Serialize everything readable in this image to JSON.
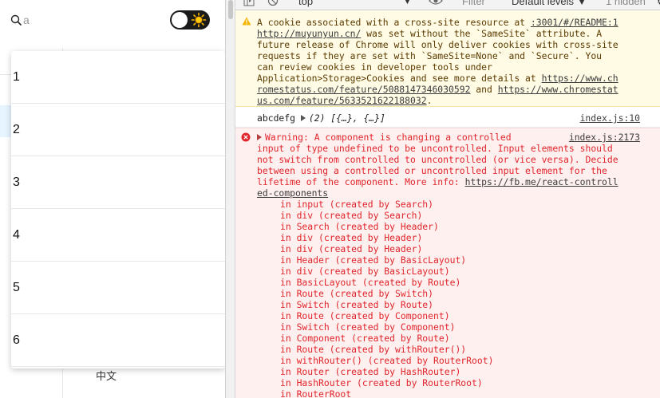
{
  "app": {
    "search_value": "a",
    "results": [
      "1",
      "2",
      "3",
      "4",
      "5",
      "6"
    ],
    "lang_label": "中文"
  },
  "devtools": {
    "toolbar": {
      "context": "top",
      "filter_placeholder": "Filter",
      "levels": "Default levels ▼",
      "hidden": "1 hidden"
    },
    "warning": {
      "source": ":3001/#/README:1",
      "line1": "A cookie associated with a cross-site resource at ",
      "url1": "http://muyunyun.cn/",
      "line2_rest": " was set without the `SameSite` attribute. A",
      "line3": "future release of Chrome will only deliver cookies with cross-site",
      "line4": "requests if they are set with `SameSite=None` and `Secure`. You",
      "line5": "can review cookies in developer tools under",
      "line6a": "Application>Storage>Cookies and see more details at ",
      "url2a": "https://www.ch",
      "url2b": "romestatus.com/feature/5088147346030592",
      "and": " and ",
      "url3a": "https://www.chromestat",
      "url3b": "us.com/feature/5633521622188032",
      "end": "."
    },
    "log": {
      "text": "abcdefg",
      "array": "(2) [{…}, {…}]",
      "source": "index.js:10"
    },
    "error": {
      "source": "index.js:2173",
      "l1": "Warning: A component is changing a controlled",
      "l2": "input of type undefined to be uncontrolled. Input elements should",
      "l3": "not switch from controlled to uncontrolled (or vice versa). Decide",
      "l4": "between using a controlled or uncontrolled input element for the",
      "l5a": "lifetime of the component. More info: ",
      "url_a": "https://fb.me/react-controll",
      "url_b": "ed-components",
      "stack": [
        "in input (created by Search)",
        "in div (created by Search)",
        "in Search (created by Header)",
        "in div (created by Header)",
        "in div (created by Header)",
        "in Header (created by BasicLayout)",
        "in div (created by BasicLayout)",
        "in BasicLayout (created by Route)",
        "in Route (created by Switch)",
        "in Switch (created by Route)",
        "in Route (created by Component)",
        "in Switch (created by Component)",
        "in Component (created by Route)",
        "in Route (created by withRouter())",
        "in withRouter() (created by RouterRoot)",
        "in Router (created by HashRouter)",
        "in HashRouter (created by RouterRoot)",
        "in RouterRoot"
      ]
    }
  },
  "colors": {
    "warning_bg": "#fffbe5",
    "error_bg": "#fff0f0",
    "error_text": "#e0252b",
    "toggle_bg": "#1a1a1a"
  },
  "icons": [
    "search-icon",
    "sun-icon",
    "sidebar-toggle-icon",
    "clear-console-icon",
    "eye-icon",
    "warning-icon",
    "error-icon",
    "expand-triangle-icon"
  ]
}
